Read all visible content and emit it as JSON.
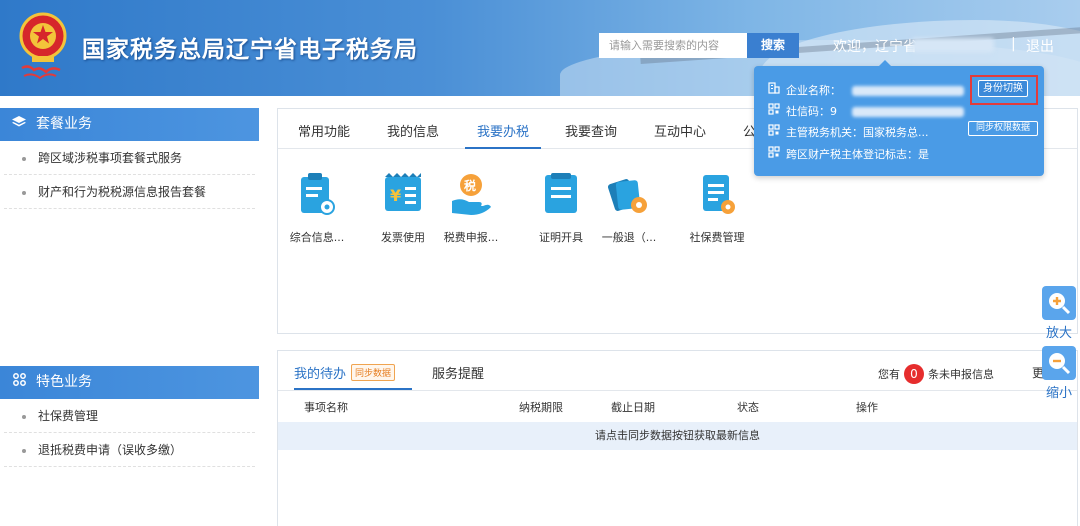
{
  "header": {
    "title": "国家税务总局辽宁省电子税务局",
    "search_placeholder": "请输入需要搜索的内容",
    "search_button": "搜索",
    "welcome": "欢迎，辽宁省",
    "separator": "|",
    "logout": "退出"
  },
  "sidebar": {
    "group1_title": "套餐业务",
    "group1_items": [
      "跨区域涉税事项套餐式服务",
      "财产和行为税税源信息报告套餐"
    ],
    "group2_title": "特色业务",
    "group2_items": [
      "社保费管理",
      "退抵税费申请（误收多缴）"
    ]
  },
  "tabs": [
    "常用功能",
    "我的信息",
    "我要办税",
    "我要查询",
    "互动中心",
    "公"
  ],
  "active_tab": "我要办税",
  "functions": [
    {
      "label": "综合信息...",
      "icon": "info-report-icon"
    },
    {
      "label": "发票使用",
      "icon": "invoice-icon"
    },
    {
      "label": "税费申报...",
      "icon": "tax-declare-icon"
    },
    {
      "label": "证明开具",
      "icon": "certificate-icon"
    },
    {
      "label": "一般退（...",
      "icon": "refund-icon"
    },
    {
      "label": "社保费管理",
      "icon": "social-insurance-icon"
    }
  ],
  "todo": {
    "tab1": "我的待办",
    "sync_badge": "同步数据",
    "tab2": "服务提醒",
    "notice_prefix": "您有",
    "notice_count": "0",
    "notice_suffix": "条未申报信息",
    "more": "更",
    "columns": [
      "事项名称",
      "纳税期限",
      "截止日期",
      "状态",
      "操作"
    ],
    "empty_text": "请点击同步数据按钮获取最新信息"
  },
  "popup": {
    "company_label": "企业名称：",
    "switch_button": "身份切换",
    "credit_label": "社信码：",
    "credit_visible": "9",
    "authority_label": "主管税务机关：",
    "authority_value": "国家税务总...",
    "sync_perm_button": "同步权限数据",
    "cross_label": "跨区财产税主体登记标志：",
    "cross_value": "是"
  },
  "zoom": {
    "in": "放大",
    "out": "缩小"
  },
  "colors": {
    "primary": "#2b73c6",
    "header": "#3b86d8",
    "badge": "#e62d2d",
    "popup": "#4a9be6"
  }
}
